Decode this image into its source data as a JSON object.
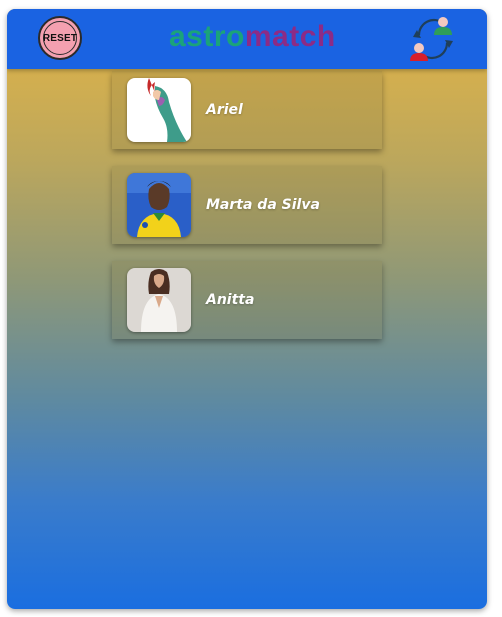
{
  "header": {
    "reset_label": "RESET",
    "logo_part1": "astro",
    "logo_part2": "match",
    "icons": {
      "reset": "reset-icon",
      "swap": "switch-screen-icon"
    }
  },
  "colors": {
    "header_bg": "#1a63e2",
    "logo_part1": "#1aa37a",
    "logo_part2": "#8c2b86",
    "gradient_top": "#e5b545",
    "gradient_bottom": "#1a6ee0"
  },
  "matches": [
    {
      "name": "Ariel"
    },
    {
      "name": "Marta da Silva"
    },
    {
      "name": "Anitta"
    }
  ]
}
